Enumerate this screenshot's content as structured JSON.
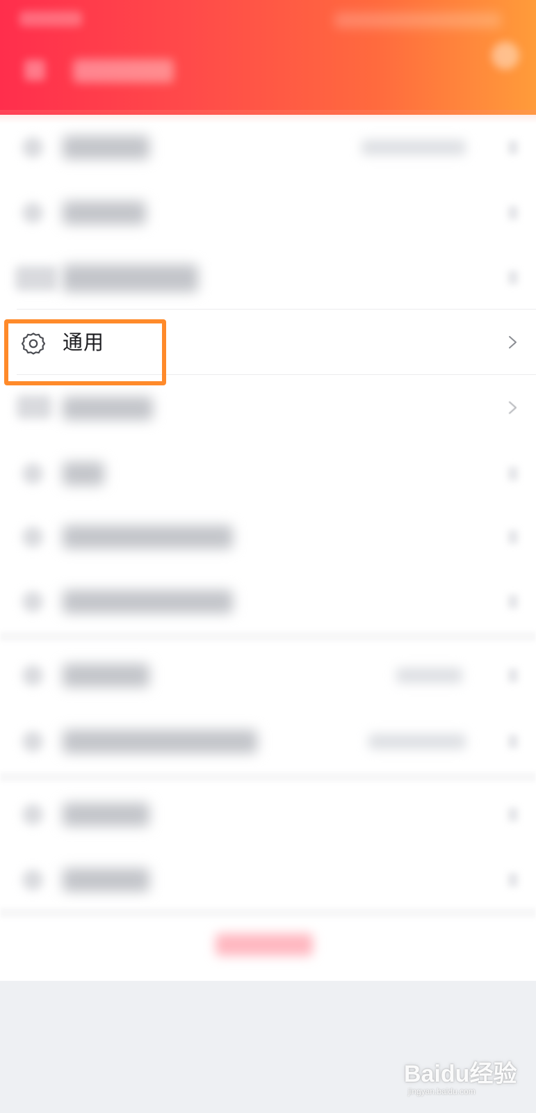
{
  "screen": {
    "accent_color": "#ff8a2a",
    "header_gradient": [
      "#ff2e4c",
      "#ff9c3a"
    ]
  },
  "settings": {
    "general_item": {
      "label": "通用",
      "icon": "gear-icon",
      "chevron": "chevron-right-icon"
    }
  },
  "watermark": {
    "brand": "Baidu经验",
    "sub": "jingyan.baidu.com"
  }
}
